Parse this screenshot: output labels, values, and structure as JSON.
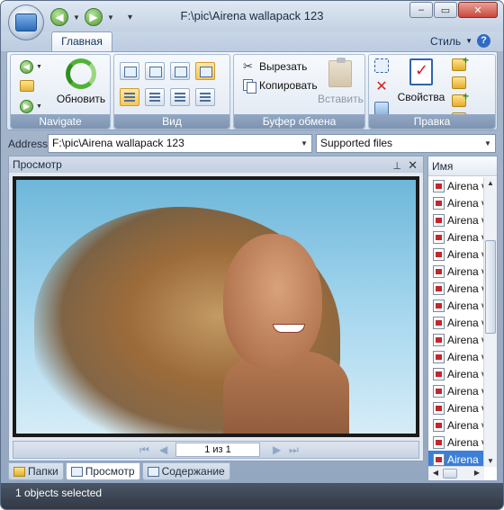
{
  "window": {
    "title": "F:\\pic\\Airena wallapack 123"
  },
  "ribbon": {
    "active_tab": "Главная",
    "style_menu": "Стиль",
    "groups": {
      "navigate": {
        "label": "Navigate",
        "refresh": "Обновить"
      },
      "view": {
        "label": "Вид"
      },
      "clipboard": {
        "label": "Буфер обмена",
        "cut": "Вырезать",
        "copy": "Копировать",
        "paste": "Вставить"
      },
      "edit": {
        "label": "Правка",
        "properties": "Свойства"
      }
    }
  },
  "address": {
    "label": "Address",
    "value": "F:\\pic\\Airena wallapack 123",
    "filter": "Supported files"
  },
  "preview": {
    "title": "Просмотр",
    "pager": {
      "page_text": "1 из 1"
    }
  },
  "pane_tabs": [
    "Папки",
    "Просмотр",
    "Содержание"
  ],
  "file_list": {
    "column": "Имя",
    "items": [
      "Airena v",
      "Airena v",
      "Airena v",
      "Airena v",
      "Airena v",
      "Airena v",
      "Airena v",
      "Airena v",
      "Airena v",
      "Airena v",
      "Airena v",
      "Airena v",
      "Airena v",
      "Airena v",
      "Airena v",
      "Airena v",
      "Airena"
    ],
    "selected_index": 16
  },
  "status": {
    "text": "1 objects selected"
  }
}
